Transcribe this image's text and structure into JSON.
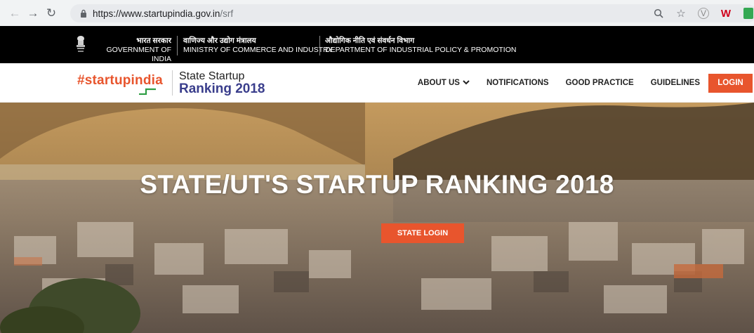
{
  "browser": {
    "url_base": "https://www.startupindia.gov.in",
    "url_path": "/srf",
    "icons": [
      "back-icon",
      "forward-icon",
      "reload-icon",
      "lock-icon",
      "zoom-icon",
      "star-icon",
      "extension-v-icon",
      "extension-w-icon",
      "extension-green-icon"
    ]
  },
  "govbar": {
    "gov_hi": "भारत सरकार",
    "gov_en": "GOVERNMENT OF INDIA",
    "ministry_hi": "वाणिज्य और उद्योग मंत्रालय",
    "ministry_en": "MINISTRY OF COMMERCE AND INDUSTRY",
    "dept_hi": "औद्योगिक नीति एवं संवर्धन विभाग",
    "dept_en": "DEPARTMENT OF INDUSTRIAL POLICY & PROMOTION"
  },
  "header": {
    "logo_text": "#startupindia",
    "title_line1": "State Startup",
    "title_line2": "Ranking 2018",
    "nav": {
      "about": "ABOUT US",
      "notifications": "NOTIFICATIONS",
      "good_practice": "GOOD PRACTICE",
      "guidelines": "GUIDELINES",
      "login": "LOGIN"
    }
  },
  "hero": {
    "title": "STATE/UT'S STARTUP RANKING 2018",
    "button": "STATE LOGIN"
  },
  "colors": {
    "accent": "#e8552d",
    "brand_blue": "#3a3e8c",
    "govbar_bg": "#000000"
  }
}
